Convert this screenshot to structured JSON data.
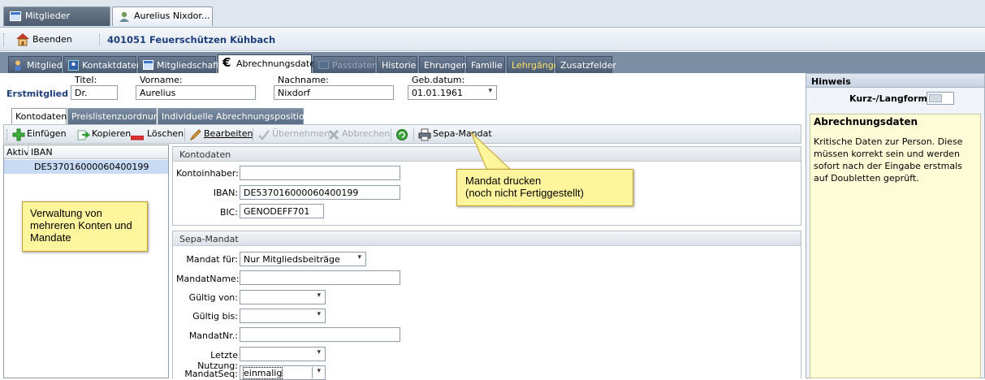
{
  "doc_tabs": [
    {
      "label": "Mitglieder",
      "icon": "window-icon"
    },
    {
      "label": "Aurelius Nixdor...",
      "icon": "user-icon",
      "close_label": "×"
    }
  ],
  "header": {
    "exit_label": "Beenden",
    "title": "401051  Feuerschützen Kühbach"
  },
  "main_tabs": [
    {
      "label": "Mitglied"
    },
    {
      "label": "Kontaktdaten"
    },
    {
      "label": "Mitgliedschaft"
    },
    {
      "label": "Abrechnungsdaten"
    },
    {
      "label": "Passdaten"
    },
    {
      "label": "Historie"
    },
    {
      "label": "Ehrungen"
    },
    {
      "label": "Familie"
    },
    {
      "label": "Lehrgänge"
    },
    {
      "label": "Zusatzfelder"
    }
  ],
  "person": {
    "status": "Erstmitglied",
    "titel_label": "Titel:",
    "titel_value": "Dr.",
    "vorname_label": "Vorname:",
    "vorname_value": "Aurelius",
    "nachname_label": "Nachname:",
    "nachname_value": "Nixdorf",
    "geb_label": "Geb.datum:",
    "geb_value": "01.01.1961"
  },
  "sub_tabs": [
    {
      "label": "Kontodaten"
    },
    {
      "label": "Preislistenzuordnung"
    },
    {
      "label": "Individuelle Abrechnungspositionen"
    }
  ],
  "toolbar": {
    "insert": "Einfügen",
    "copy": "Kopieren",
    "delete": "Löschen",
    "edit": "Bearbeiten",
    "apply": "Übernehmen",
    "cancel": "Abbrechen",
    "sepa": "Sepa-Mandat"
  },
  "grid": {
    "col_active": "Aktiv",
    "col_iban": "IBAN",
    "rows": [
      {
        "iban": "DE537016000060400199"
      }
    ]
  },
  "kontodaten": {
    "title": "Kontodaten",
    "inhaber_label": "Kontoinhaber:",
    "inhaber_value": "",
    "iban_label": "IBAN:",
    "iban_value": "DE537016000060400199",
    "bic_label": "BIC:",
    "bic_value": "GENODEFF701"
  },
  "sepa": {
    "title": "Sepa-Mandat",
    "fuer_label": "Mandat für:",
    "fuer_value": "Nur Mitgliedsbeiträge",
    "name_label": "MandatName:",
    "name_value": "",
    "von_label": "Gültig von:",
    "von_value": "",
    "bis_label": "Gültig bis:",
    "bis_value": "",
    "nr_label": "MandatNr.:",
    "nr_value": "",
    "nutzung_label": "Letzte Nutzung:",
    "nutzung_value": "",
    "seq_label": "MandatSeq:",
    "seq_value": "einmalig"
  },
  "callouts": {
    "left": "Verwaltung von mehreren Konten und Mandate",
    "right_line1": "Mandat drucken",
    "right_line2": "(noch nicht Fertiggestellt)"
  },
  "hinweis": {
    "title": "Hinweis",
    "toggle_label": "Kurz-/Langform",
    "note_title": "Abrechnungsdaten",
    "note_text": "Kritische Daten zur Person. Diese müssen korrekt sein und werden sofort nach der Eingabe erstmals auf Doubletten geprüft."
  },
  "colors": {
    "header_title": "#1f3e7a",
    "callout_bg": "#fff59d",
    "note_bg": "#fefcd7",
    "selection": "#c8daf4"
  }
}
